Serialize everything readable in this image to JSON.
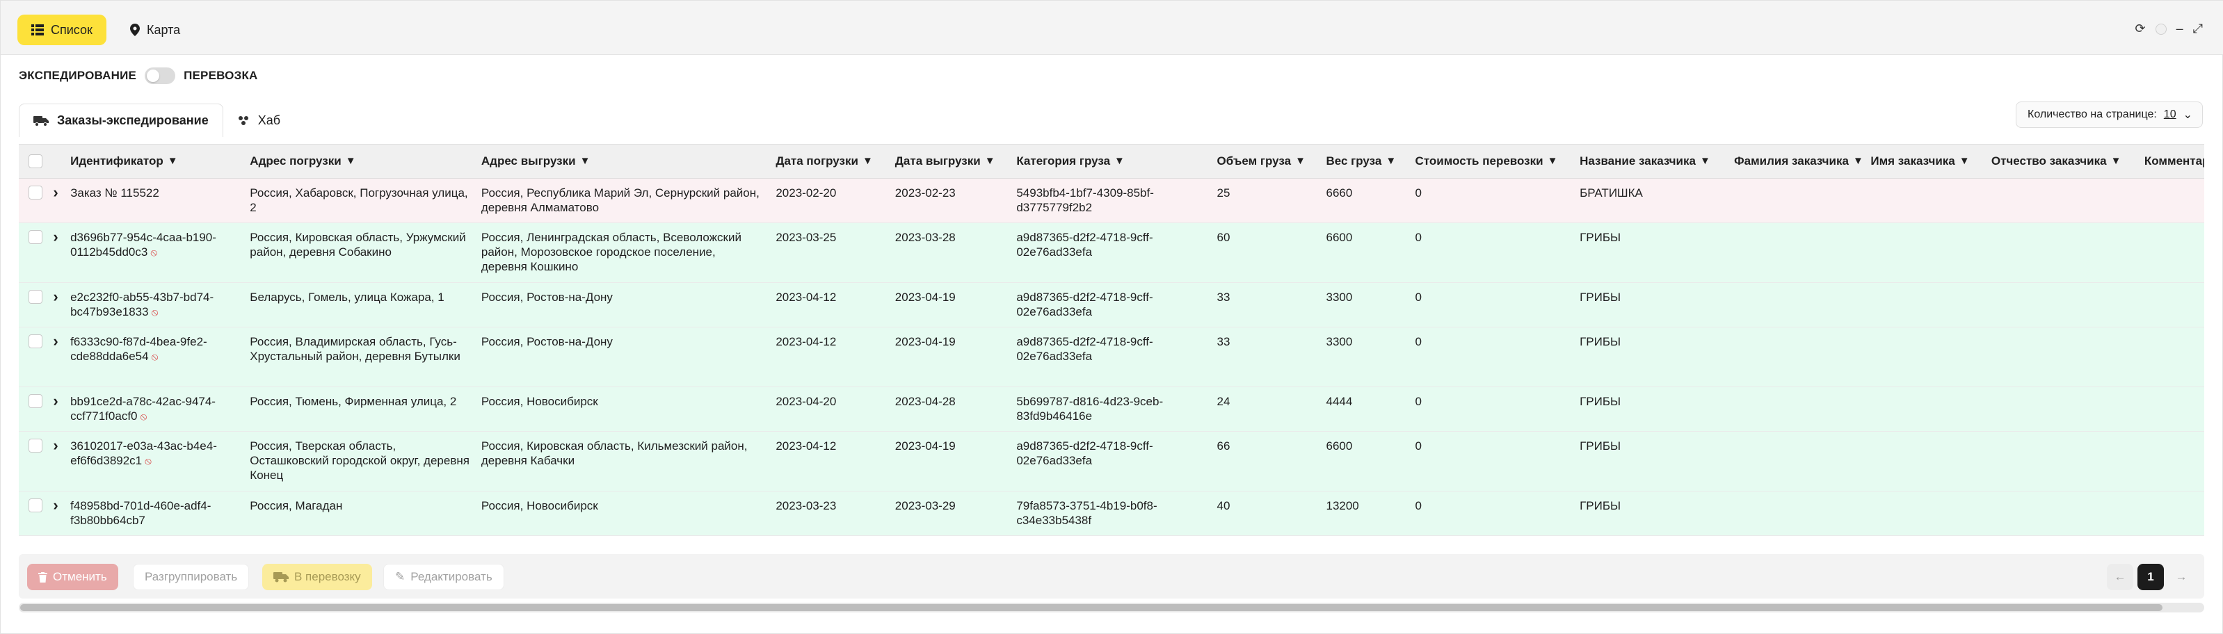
{
  "topbar": {
    "list_label": "Список",
    "map_label": "Карта"
  },
  "toggle": {
    "left_label": "ЭКСПЕДИРОВАНИЕ",
    "right_label": "ПЕРЕВОЗКА"
  },
  "tabs": [
    {
      "label": "Заказы-экспедирование",
      "icon": "truck-icon"
    },
    {
      "label": "Хаб",
      "icon": "hub-icon"
    }
  ],
  "page_size": {
    "label": "Количество на странице:",
    "value": "10"
  },
  "table": {
    "columns": [
      "Идентификатор",
      "Адрес погрузки",
      "Адрес выгрузки",
      "Дата погрузки",
      "Дата выгрузки",
      "Категория груза",
      "Объем груза",
      "Вес груза",
      "Стоимость перевозки",
      "Название заказчика",
      "Фамилия заказчика",
      "Имя заказчика",
      "Отчество заказчика",
      "Комментарий"
    ],
    "rows": [
      {
        "id": "Заказ № 115522",
        "banned": false,
        "load": "Россия, Хабаровск, Погрузочная улица, 2",
        "unload": "Россия, Республика Марий Эл, Сернурский район, деревня Алмаматово",
        "load_date": "2023-02-20",
        "unload_date": "2023-02-23",
        "category": "5493bfb4-1bf7-4309-85bf-d3775779f2b2",
        "volume": "25",
        "weight": "6660",
        "cost": "0",
        "customer": "БРАТИШКА",
        "surname": "",
        "name": "",
        "patronymic": "",
        "comment": ""
      },
      {
        "id": "d3696b77-954c-4caa-b190-0112b45dd0c3",
        "banned": true,
        "load": "Россия, Кировская область, Уржумский район, деревня Собакино",
        "unload": "Россия, Ленинградская область, Всеволожский район, Морозовское городское поселение, деревня Кошкино",
        "load_date": "2023-03-25",
        "unload_date": "2023-03-28",
        "category": "a9d87365-d2f2-4718-9cff-02e76ad33efa",
        "volume": "60",
        "weight": "6600",
        "cost": "0",
        "customer": "ГРИБЫ",
        "surname": "",
        "name": "",
        "patronymic": "",
        "comment": ""
      },
      {
        "id": "e2c232f0-ab55-43b7-bd74-bc47b93e1833",
        "banned": true,
        "load": "Беларусь, Гомель, улица Кожара, 1",
        "unload": "Россия, Ростов-на-Дону",
        "load_date": "2023-04-12",
        "unload_date": "2023-04-19",
        "category": "a9d87365-d2f2-4718-9cff-02e76ad33efa",
        "volume": "33",
        "weight": "3300",
        "cost": "0",
        "customer": "ГРИБЫ",
        "surname": "",
        "name": "",
        "patronymic": "",
        "comment": ""
      },
      {
        "id": "f6333c90-f87d-4bea-9fe2-cde88dda6e54",
        "banned": true,
        "load": "Россия, Владимирская область, Гусь-Хрустальный район, деревня Бутылки",
        "unload": "Россия, Ростов-на-Дону",
        "load_date": "2023-04-12",
        "unload_date": "2023-04-19",
        "category": "a9d87365-d2f2-4718-9cff-02e76ad33efa",
        "volume": "33",
        "weight": "3300",
        "cost": "0",
        "customer": "ГРИБЫ",
        "surname": "",
        "name": "",
        "patronymic": "",
        "comment": ""
      },
      {
        "id": "bb91ce2d-a78c-42ac-9474-ccf771f0acf0",
        "banned": true,
        "load": "Россия, Тюмень, Фирменная улица, 2",
        "unload": "Россия, Новосибирск",
        "load_date": "2023-04-20",
        "unload_date": "2023-04-28",
        "category": "5b699787-d816-4d23-9ceb-83fd9b46416e",
        "volume": "24",
        "weight": "4444",
        "cost": "0",
        "customer": "ГРИБЫ",
        "surname": "",
        "name": "",
        "patronymic": "",
        "comment": ""
      },
      {
        "id": "36102017-e03a-43ac-b4e4-ef6f6d3892c1",
        "banned": true,
        "load": "Россия, Тверская область, Осташковский городской округ, деревня Конец",
        "unload": "Россия, Кировская область, Кильмезский район, деревня Кабачки",
        "load_date": "2023-04-12",
        "unload_date": "2023-04-19",
        "category": "a9d87365-d2f2-4718-9cff-02e76ad33efa",
        "volume": "66",
        "weight": "6600",
        "cost": "0",
        "customer": "ГРИБЫ",
        "surname": "",
        "name": "",
        "patronymic": "",
        "comment": ""
      },
      {
        "id": "f48958bd-701d-460e-adf4-f3b80bb64cb7",
        "banned": false,
        "load": "Россия, Магадан",
        "unload": "Россия, Новосибирск",
        "load_date": "2023-03-23",
        "unload_date": "2023-03-29",
        "category": "79fa8573-3751-4b19-b0f8-c34e33b5438f",
        "volume": "40",
        "weight": "13200",
        "cost": "0",
        "customer": "ГРИБЫ",
        "surname": "",
        "name": "",
        "patronymic": "",
        "comment": ""
      }
    ]
  },
  "actions": {
    "cancel": "Отменить",
    "ungroup": "Разгруппировать",
    "to_transport": "В перевозку",
    "edit": "Редактировать"
  },
  "pagination": {
    "current": "1"
  },
  "colors": {
    "accent": "#fde13a",
    "row_pink": "#fbf1f3",
    "row_green": "#e6fbf1",
    "danger": "#d94141"
  }
}
